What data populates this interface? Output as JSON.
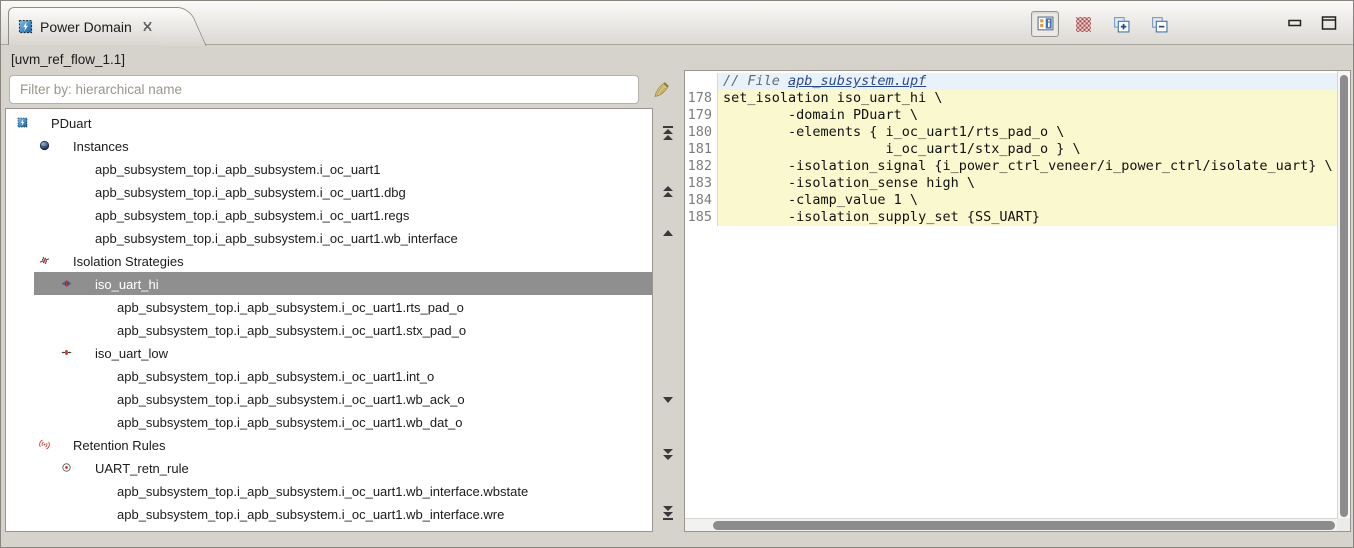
{
  "tab": {
    "title": "Power Domain"
  },
  "toolbar": {
    "buttons": [
      {
        "name": "toggle-details-view-button",
        "icon": "view-toggle",
        "pressed": true
      },
      {
        "name": "pattern-filter-button",
        "icon": "red-checker",
        "pressed": false
      },
      {
        "name": "expand-all-button",
        "icon": "expand-all",
        "pressed": false
      },
      {
        "name": "collapse-all-button",
        "icon": "collapse-all",
        "pressed": false
      }
    ],
    "window_buttons": [
      {
        "name": "minimize-view-button",
        "icon": "minimize"
      },
      {
        "name": "maximize-view-button",
        "icon": "maximize"
      }
    ]
  },
  "left_panel": {
    "scope_label": "[uvm_ref_flow_1.1]",
    "filter_placeholder": "Filter by: hierarchical name",
    "clear_filter_icon": "brush-icon",
    "tree": [
      {
        "label": "PDuart",
        "level": 0,
        "icon": "power-domain",
        "expander": true
      },
      {
        "label": "Instances",
        "level": 1,
        "icon": "instances",
        "expander": true
      },
      {
        "label": "apb_subsystem_top.i_apb_subsystem.i_oc_uart1",
        "level": 2,
        "icon": "module",
        "expander": false
      },
      {
        "label": "apb_subsystem_top.i_apb_subsystem.i_oc_uart1.dbg",
        "level": 2,
        "icon": "module",
        "expander": false
      },
      {
        "label": "apb_subsystem_top.i_apb_subsystem.i_oc_uart1.regs",
        "level": 2,
        "icon": "module",
        "expander": false
      },
      {
        "label": "apb_subsystem_top.i_apb_subsystem.i_oc_uart1.wb_interface",
        "level": 2,
        "icon": "module",
        "expander": false
      },
      {
        "label": "Isolation Strategies",
        "level": 1,
        "icon": "isolation-strategies",
        "expander": true
      },
      {
        "label": "iso_uart_hi",
        "level": 2,
        "icon": "isolation-hi",
        "expander": true,
        "selected": true
      },
      {
        "label": "apb_subsystem_top.i_apb_subsystem.i_oc_uart1.rts_pad_o",
        "level": 3,
        "icon": "port",
        "expander": false
      },
      {
        "label": "apb_subsystem_top.i_apb_subsystem.i_oc_uart1.stx_pad_o",
        "level": 3,
        "icon": "port",
        "expander": false
      },
      {
        "label": "iso_uart_low",
        "level": 2,
        "icon": "isolation-low",
        "expander": true
      },
      {
        "label": "apb_subsystem_top.i_apb_subsystem.i_oc_uart1.int_o",
        "level": 3,
        "icon": "port",
        "expander": false
      },
      {
        "label": "apb_subsystem_top.i_apb_subsystem.i_oc_uart1.wb_ack_o",
        "level": 3,
        "icon": "port",
        "expander": false
      },
      {
        "label": "apb_subsystem_top.i_apb_subsystem.i_oc_uart1.wb_dat_o",
        "level": 3,
        "icon": "port",
        "expander": false
      },
      {
        "label": "Retention Rules",
        "level": 1,
        "icon": "retention-rules",
        "expander": true
      },
      {
        "label": "UART_retn_rule",
        "level": 2,
        "icon": "retention-rule",
        "expander": true
      },
      {
        "label": "apb_subsystem_top.i_apb_subsystem.i_oc_uart1.wb_interface.wbstate",
        "level": 3,
        "icon": "retention-element",
        "expander": false
      },
      {
        "label": "apb_subsystem_top.i_apb_subsystem.i_oc_uart1.wb_interface.wre",
        "level": 3,
        "icon": "retention-element",
        "expander": false
      }
    ]
  },
  "nav_strip": {
    "icons": [
      {
        "name": "scroll-to-top-icon",
        "icon": "nav-top"
      },
      {
        "name": "page-up-icon",
        "icon": "nav-pgup"
      },
      {
        "name": "scroll-up-icon",
        "icon": "nav-up"
      },
      {
        "name": "scroll-down-icon",
        "icon": "nav-down"
      },
      {
        "name": "page-down-icon",
        "icon": "nav-pgdn"
      },
      {
        "name": "scroll-to-bottom-icon",
        "icon": "nav-bottom"
      }
    ]
  },
  "code_panel": {
    "header": {
      "comment": "// File ",
      "filename": "apb_subsystem.upf"
    },
    "lines": [
      {
        "num": "178",
        "text": "set_isolation iso_uart_hi \\"
      },
      {
        "num": "179",
        "text": "        -domain PDuart \\"
      },
      {
        "num": "180",
        "text": "        -elements { i_oc_uart1/rts_pad_o \\"
      },
      {
        "num": "181",
        "text": "                    i_oc_uart1/stx_pad_o } \\"
      },
      {
        "num": "182",
        "text": "        -isolation_signal {i_power_ctrl_veneer/i_power_ctrl/isolate_uart} \\"
      },
      {
        "num": "183",
        "text": "        -isolation_sense high \\"
      },
      {
        "num": "184",
        "text": "        -clamp_value 1 \\"
      },
      {
        "num": "185",
        "text": "        -isolation_supply_set {SS_UART}"
      }
    ]
  },
  "colors": {
    "selection_gray": "#8f8f8f",
    "highlight_yellow": "#faf8cf",
    "header_blue": "#e9f1fb",
    "accent_red": "#c0392b",
    "accent_blue": "#2d5fa8",
    "chrome_gray": "#d6d2cc"
  }
}
